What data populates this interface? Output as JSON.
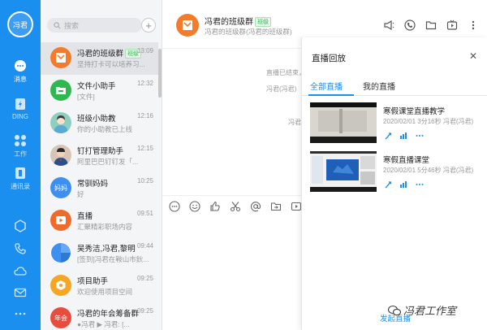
{
  "nav": {
    "avatar": "冯君",
    "items": [
      {
        "label": "消息"
      },
      {
        "label": "DING"
      },
      {
        "label": "工作"
      },
      {
        "label": "通讯录"
      }
    ]
  },
  "search": {
    "placeholder": "搜索"
  },
  "chats": [
    {
      "name": "冯君的班级群",
      "badge": "班级",
      "sub": "坚持打卡可以培养习...",
      "time": "13:09",
      "color": "#f47a2c"
    },
    {
      "name": "文件小助手",
      "sub": "[文件]",
      "time": "12:32",
      "color": "#2fb84f"
    },
    {
      "name": "班级小助教",
      "sub": "你的小助教已上线",
      "time": "12:16",
      "color": "#6fbf9d"
    },
    {
      "name": "钉打管理助手",
      "sub": "阿里巴巴钉钉发「...",
      "time": "12:15",
      "color": "#b07a5a"
    },
    {
      "name": "常驯妈妈",
      "sub": "好",
      "time": "10:25",
      "color": "#3d8ff0",
      "av": "妈妈"
    },
    {
      "name": "直播",
      "sub": "汇聚精彩职场内容",
      "time": "09:51",
      "color": "#f06a2c"
    },
    {
      "name": "吴秀洁,冯君,黎明",
      "sub": "[签到]冯君在鞍山市鈥...",
      "time": "09:44",
      "color": "#3d8ff0"
    },
    {
      "name": "项目助手",
      "sub": "欢迎使用项目空间",
      "time": "09:25",
      "color": "#f5a623"
    },
    {
      "name": "冯君的年会筹备群",
      "sub": "●冯君 ▶ 冯君: [...",
      "time": "09:25",
      "color": "#e94b3c",
      "av": "年会"
    }
  ],
  "chat": {
    "title": "冯君的班级群",
    "badge": "班级",
    "subtitle": "冯君的班级群(冯君的班级群)",
    "sys1": "直播已结束，",
    "sys2": "冯君(冯君)",
    "sys3": "冯君"
  },
  "panel": {
    "title": "直播回放",
    "tabs": [
      "全部直播",
      "我的直播"
    ],
    "items": [
      {
        "title": "寒假课堂直播教学",
        "meta": "2020/02/01 3分16秒 冯君(冯君)"
      },
      {
        "title": "寒假直播课堂",
        "meta": "2020/02/01 5分46秒 冯君(冯君)"
      }
    ],
    "start": "发起直播"
  },
  "watermark": "冯君工作室"
}
